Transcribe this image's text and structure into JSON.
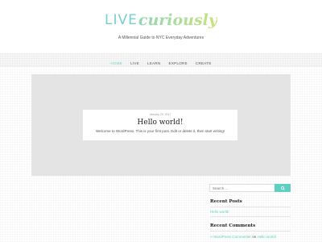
{
  "site": {
    "logo_word": "LIVE",
    "logo_script": "curiously",
    "tagline": "A Millennial Guide to NYC Everyday Adventures"
  },
  "nav": {
    "items": [
      {
        "label": "HOME"
      },
      {
        "label": "LIVE"
      },
      {
        "label": "LEARN"
      },
      {
        "label": "EXPLORE"
      },
      {
        "label": "CREATE"
      }
    ]
  },
  "post": {
    "date": "January 20, 2017",
    "title": "Hello world!",
    "excerpt": "Welcome to WordPress. This is your first post. Edit or delete it, then start writing!"
  },
  "sidebar": {
    "search_placeholder": "Search ...",
    "recent_posts_title": "Recent Posts",
    "recent_posts": [
      {
        "label": "Hello world!"
      }
    ],
    "recent_comments_title": "Recent Comments",
    "comment": {
      "author": "A WordPress Commenter",
      "on": "on",
      "post": "Hello world!"
    }
  },
  "colors": {
    "accent": "#5ecfc1",
    "hero_background": "#e4e4e4"
  }
}
